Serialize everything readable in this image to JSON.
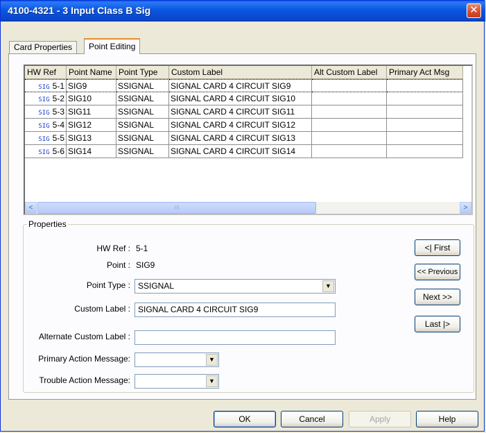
{
  "window": {
    "title": "4100-4321 - 3 Input Class B Sig",
    "close_symbol": "✕"
  },
  "tabs": {
    "card_properties": "Card Properties",
    "point_editing": "Point Editing"
  },
  "grid": {
    "columns": [
      "HW Ref",
      "Point Name",
      "Point Type",
      "Custom Label",
      "Alt Custom Label",
      "Primary Act Msg"
    ],
    "rows": [
      {
        "icon": "SIG",
        "hw": "5-1",
        "name": "SIG9",
        "type": "SSIGNAL",
        "label": "SIGNAL CARD 4 CIRCUIT SIG9",
        "alt": "",
        "msg": ""
      },
      {
        "icon": "SIG",
        "hw": "5-2",
        "name": "SIG10",
        "type": "SSIGNAL",
        "label": "SIGNAL CARD 4 CIRCUIT SIG10",
        "alt": "",
        "msg": ""
      },
      {
        "icon": "SIG",
        "hw": "5-3",
        "name": "SIG11",
        "type": "SSIGNAL",
        "label": "SIGNAL CARD 4 CIRCUIT SIG11",
        "alt": "",
        "msg": ""
      },
      {
        "icon": "SIG",
        "hw": "5-4",
        "name": "SIG12",
        "type": "SSIGNAL",
        "label": "SIGNAL CARD 4 CIRCUIT SIG12",
        "alt": "",
        "msg": ""
      },
      {
        "icon": "SIG",
        "hw": "5-5",
        "name": "SIG13",
        "type": "SSIGNAL",
        "label": "SIGNAL CARD 4 CIRCUIT SIG13",
        "alt": "",
        "msg": ""
      },
      {
        "icon": "SIG",
        "hw": "5-6",
        "name": "SIG14",
        "type": "SSIGNAL",
        "label": "SIGNAL CARD 4 CIRCUIT SIG14",
        "alt": "",
        "msg": ""
      }
    ],
    "selected_row": 0,
    "scroll_left": "<",
    "scroll_right": ">",
    "thumb_grip": "III"
  },
  "properties": {
    "legend": "Properties",
    "hw_ref_label": "HW Ref :",
    "hw_ref_value": "5-1",
    "point_label": "Point :",
    "point_value": "SIG9",
    "point_type_label": "Point Type :",
    "point_type_value": "SSIGNAL",
    "custom_label_label": "Custom Label :",
    "custom_label_value": "SIGNAL CARD 4 CIRCUIT SIG9",
    "alt_custom_label_label": "Alternate Custom Label :",
    "alt_custom_label_value": "",
    "primary_msg_label": "Primary Action Message:",
    "primary_msg_value": "",
    "trouble_msg_label": "Trouble Action Message:",
    "trouble_msg_value": ""
  },
  "nav_buttons": {
    "first": "<| First",
    "previous": "<< Previous",
    "next": "Next >>",
    "last": "Last |>"
  },
  "footer_buttons": {
    "ok": "OK",
    "cancel": "Cancel",
    "apply": "Apply",
    "help": "Help"
  }
}
